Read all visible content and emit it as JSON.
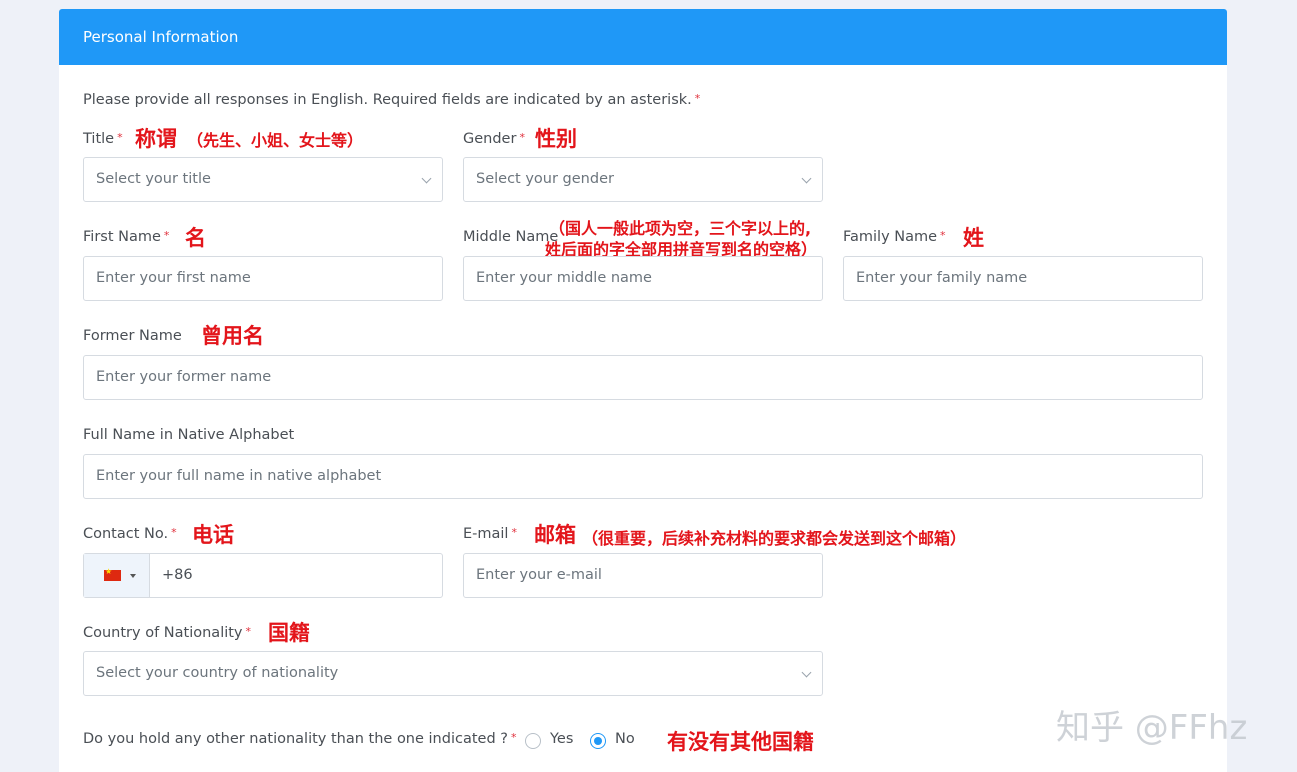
{
  "header": {
    "title": "Personal Information"
  },
  "intro": "Please provide all responses in English. Required fields are indicated by an asterisk.",
  "required_mark": "*",
  "fields": {
    "title": {
      "label": "Title",
      "placeholder": "Select your title",
      "note": "称谓",
      "note_extra": "（先生、小姐、女士等）"
    },
    "gender": {
      "label": "Gender",
      "placeholder": "Select your gender",
      "note": "性别"
    },
    "first_name": {
      "label": "First Name",
      "placeholder": "Enter your first name",
      "note": "名"
    },
    "middle_name": {
      "label": "Middle Name",
      "placeholder": "Enter your middle name",
      "note_line1": "（国人一般此项为空，三个字以上的,",
      "note_line2": "姓后面的字全部用拼音写到名的空格）"
    },
    "family_name": {
      "label": "Family Name",
      "placeholder": "Enter your family name",
      "note": "姓"
    },
    "former_name": {
      "label": "Former Name",
      "placeholder": "Enter your former name",
      "note": "曾用名"
    },
    "native_name": {
      "label": "Full Name in Native Alphabet",
      "placeholder": "Enter your full name in native alphabet"
    },
    "contact": {
      "label": "Contact No.",
      "value": "+86",
      "note": "电话"
    },
    "email": {
      "label": "E-mail",
      "placeholder": "Enter your e-mail",
      "note": "邮箱",
      "note_extra": "（很重要，后续补充材料的要求都会发送到这个邮箱）"
    },
    "nationality": {
      "label": "Country of Nationality",
      "placeholder": "Select your country of nationality",
      "note": "国籍"
    },
    "other_nationality": {
      "question": "Do you hold any other nationality than the one indicated ?",
      "yes": "Yes",
      "no": "No",
      "selected": "No",
      "note": "有没有其他国籍"
    }
  },
  "watermark": "知乎 @FFhz",
  "colors": {
    "header": "#1f98f7",
    "annotation": "#e3151b",
    "required": "#e0303c"
  }
}
